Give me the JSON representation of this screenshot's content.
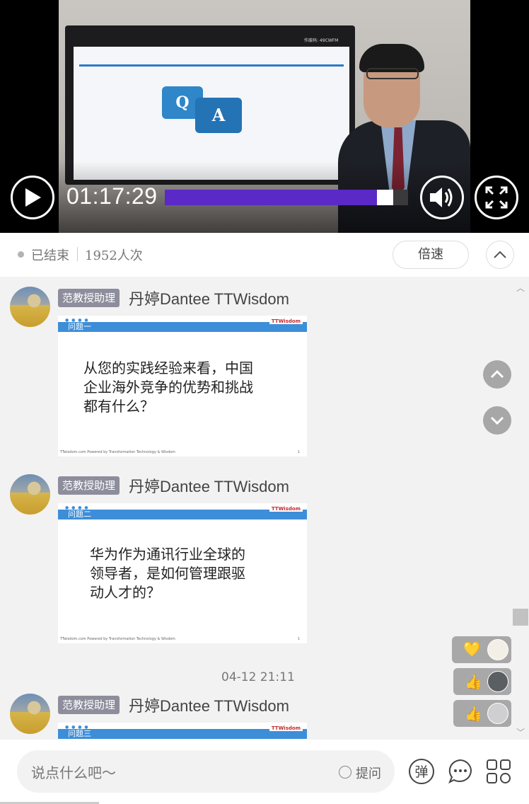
{
  "player": {
    "time": "01:17:29",
    "progress_fraction": 0.935,
    "screen_watermark": "作废码: 49CWFM",
    "qa_q": "Q",
    "qa_a": "A"
  },
  "status": {
    "state": "已结束",
    "viewers": "1952人次",
    "speed_label": "倍速"
  },
  "messages": [
    {
      "role": "范教授助理",
      "author": "丹婷Dantee TTWisdom",
      "slide_title": "问题一",
      "slide_text": [
        "从您的实践经验来看，中国",
        "企业海外竞争的优势和挑战",
        "都有什么？"
      ],
      "slide_footer": "TTwisdom.com  Powered by Transformation Technology & Wisdom",
      "slide_page": "1"
    },
    {
      "role": "范教授助理",
      "author": "丹婷Dantee TTWisdom",
      "slide_title": "问题二",
      "slide_text": [
        "华为作为通讯行业全球的",
        "领导者，是如何管理跟驱",
        "动人才的？"
      ],
      "slide_footer": "TTwisdom.com  Powered by Transformation Technology & Wisdom",
      "slide_page": "1"
    },
    {
      "timestamp": "04-12 21:11",
      "role": "范教授助理",
      "author": "丹婷Dantee TTWisdom",
      "slide_title": "问题三"
    }
  ],
  "slide_logo": "TTWisdom",
  "reactions": [
    {
      "emoji": "💛"
    },
    {
      "emoji": "👍"
    },
    {
      "emoji": "👍"
    }
  ],
  "input": {
    "placeholder": "说点什么吧～",
    "ask_label": "提问",
    "danmaku_label": "弹"
  },
  "colors": {
    "accent": "#5b29c6",
    "slide_blue": "#3d8ed9",
    "tag_gray": "#8d8d9c"
  }
}
